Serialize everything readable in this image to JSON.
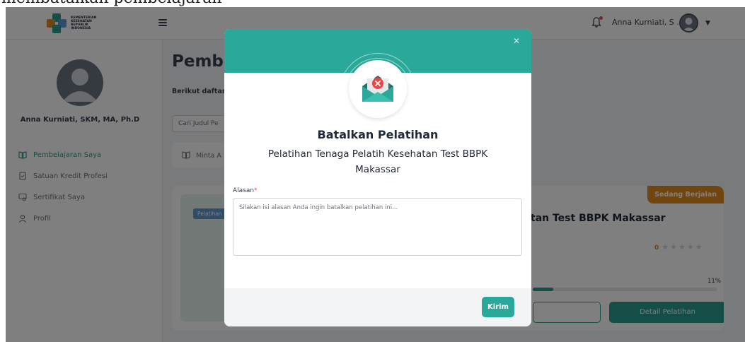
{
  "caption": "membatalkan pembelajaran",
  "header": {
    "logo_lines": [
      "KEMENTERIAN",
      "KESEHATAN",
      "REPUBLIK",
      "INDONESIA"
    ],
    "user_name": "Anna Kurniati, S ...",
    "icons": [
      "hamburger-icon",
      "bell-icon",
      "avatar",
      "caret-down-icon"
    ]
  },
  "sidebar": {
    "profile_name": "Anna Kurniati, SKM, MA, Ph.D",
    "items": [
      {
        "label": "Pembelajaran Saya",
        "icon": "book-open-icon",
        "active": true
      },
      {
        "label": "Satuan Kredit Profesi",
        "icon": "document-icon",
        "active": false
      },
      {
        "label": "Sertifikat Saya",
        "icon": "certificate-icon",
        "active": false
      },
      {
        "label": "Profil",
        "icon": "user-icon",
        "active": false
      }
    ]
  },
  "main": {
    "title": "Pembe",
    "subtitle": "Berikut daftar p",
    "search_placeholder": "Cari Judul Pe",
    "tab_label": "Minta A",
    "card": {
      "thumb_badge": "Pelatihan",
      "status": "Sedang Berjalan",
      "title": "tan Test BBPK Makassar",
      "rating_value": "0",
      "rating_max": 5,
      "progress_label": "11%",
      "progress_fraction": 0.11,
      "detail_button": "Detail Pelatihan"
    }
  },
  "modal": {
    "close_icon": "close-icon",
    "title": "Batalkan Pelatihan",
    "subtitle": "Pelatihan Tenaga Pelatih Kesehatan Test BBPK Makassar",
    "field_label": "Alasan",
    "required_mark": "*",
    "textarea_placeholder": "Silakan isi alasan Anda ingin batalkan pelatihan ini...",
    "textarea_value": "",
    "submit_label": "Kirim"
  },
  "colors": {
    "accent": "#2aa99a",
    "status_badge": "#e08a1e",
    "danger": "#ef4444",
    "overlay": "rgba(0,0,0,0.5)"
  }
}
